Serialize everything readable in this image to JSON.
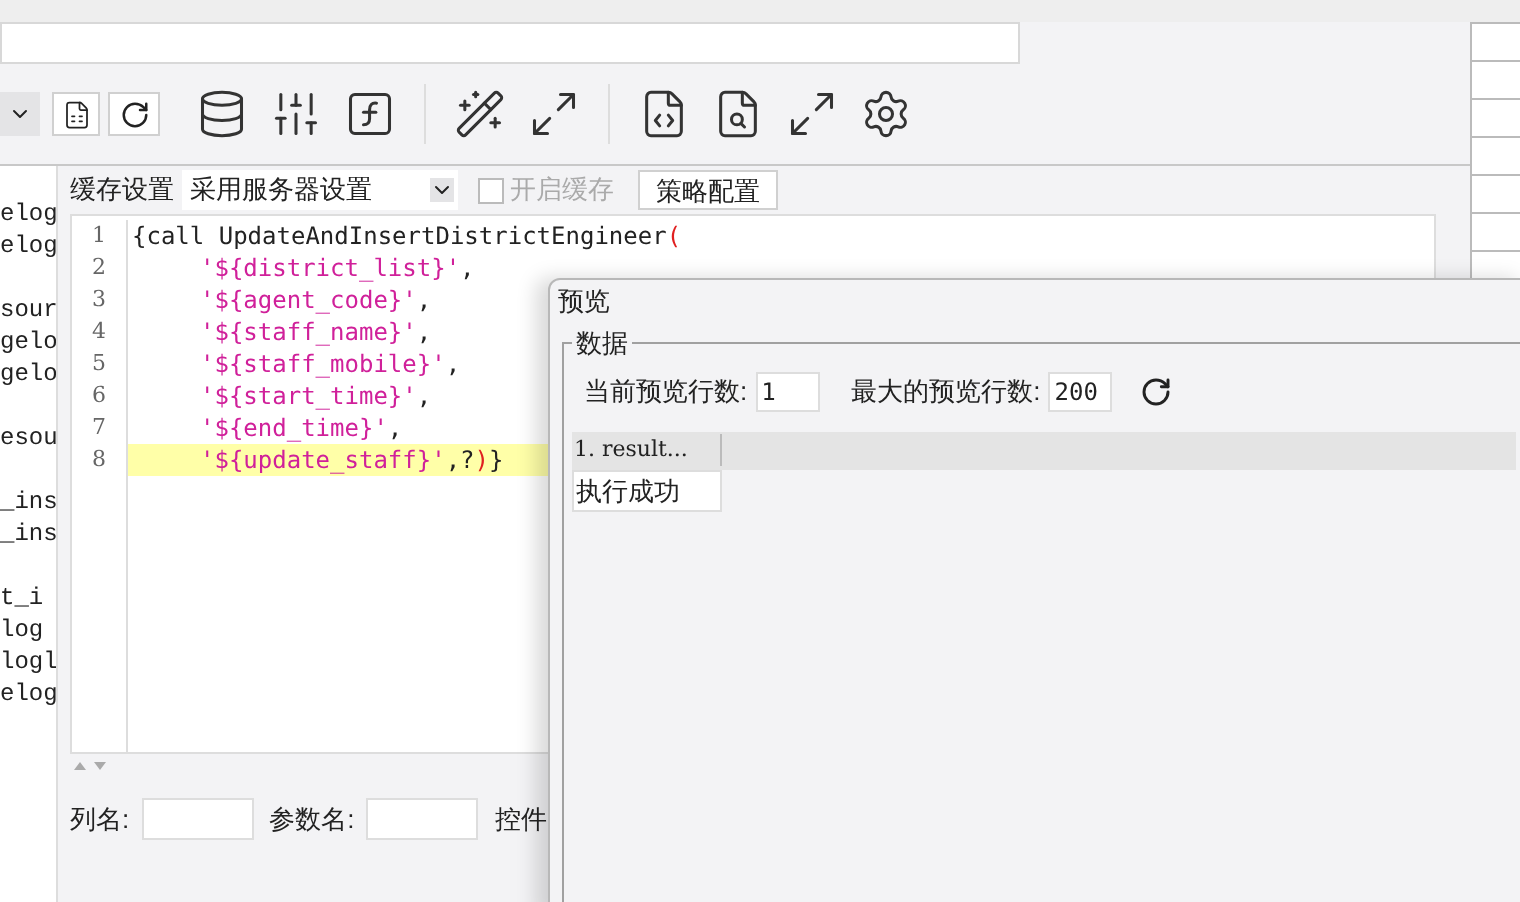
{
  "left_tree": {
    "items": [
      "elog",
      "elog",
      "sour",
      "gelo",
      "gelo",
      "esou",
      "_ins",
      "_ins",
      "t_i",
      "log",
      "logl",
      "elog"
    ]
  },
  "cache_bar": {
    "label": "缓存设置",
    "select": "采用服务器设置",
    "enable_cache": {
      "label": "开启缓存",
      "checked": false,
      "disabled": true
    },
    "strategy_button": "策略配置"
  },
  "editor": {
    "lines": [
      {
        "number": "1",
        "indented": false,
        "highlighted": false,
        "tokens": [
          {
            "kind": "plain",
            "text": "{call UpdateAndInsertDistrictEngineer"
          },
          {
            "kind": "paren",
            "text": "("
          }
        ]
      },
      {
        "number": "2",
        "indented": true,
        "highlighted": false,
        "tokens": [
          {
            "kind": "string",
            "text": "'${district_list}'"
          },
          {
            "kind": "plain",
            "text": ","
          }
        ]
      },
      {
        "number": "3",
        "indented": true,
        "highlighted": false,
        "tokens": [
          {
            "kind": "string",
            "text": "'${agent_code}'"
          },
          {
            "kind": "plain",
            "text": ","
          }
        ]
      },
      {
        "number": "4",
        "indented": true,
        "highlighted": false,
        "tokens": [
          {
            "kind": "string",
            "text": "'${staff_name}'"
          },
          {
            "kind": "plain",
            "text": ","
          }
        ]
      },
      {
        "number": "5",
        "indented": true,
        "highlighted": false,
        "tokens": [
          {
            "kind": "string",
            "text": "'${staff_mobile}'"
          },
          {
            "kind": "plain",
            "text": ","
          }
        ]
      },
      {
        "number": "6",
        "indented": true,
        "highlighted": false,
        "tokens": [
          {
            "kind": "string",
            "text": "'${start_time}'"
          },
          {
            "kind": "plain",
            "text": ","
          }
        ]
      },
      {
        "number": "7",
        "indented": true,
        "highlighted": false,
        "tokens": [
          {
            "kind": "string",
            "text": "'${end_time}'"
          },
          {
            "kind": "plain",
            "text": ","
          }
        ]
      },
      {
        "number": "8",
        "indented": true,
        "highlighted": true,
        "tokens": [
          {
            "kind": "string",
            "text": "'${update_staff}'"
          },
          {
            "kind": "plain",
            "text": ",?"
          },
          {
            "kind": "paren",
            "text": ")"
          },
          {
            "kind": "plain",
            "text": "}"
          }
        ]
      }
    ]
  },
  "params": {
    "column_name_label": "列名:",
    "param_name_label": "参数名:",
    "control_label": "控件"
  },
  "preview": {
    "title": "预览",
    "group": "数据",
    "current_rows_label": "当前预览行数:",
    "current_rows": "1",
    "max_rows_label": "最大的预览行数:",
    "max_rows": "200",
    "table": {
      "columns": [
        "1. result..."
      ],
      "rows": [
        [
          "执行成功"
        ]
      ]
    }
  }
}
